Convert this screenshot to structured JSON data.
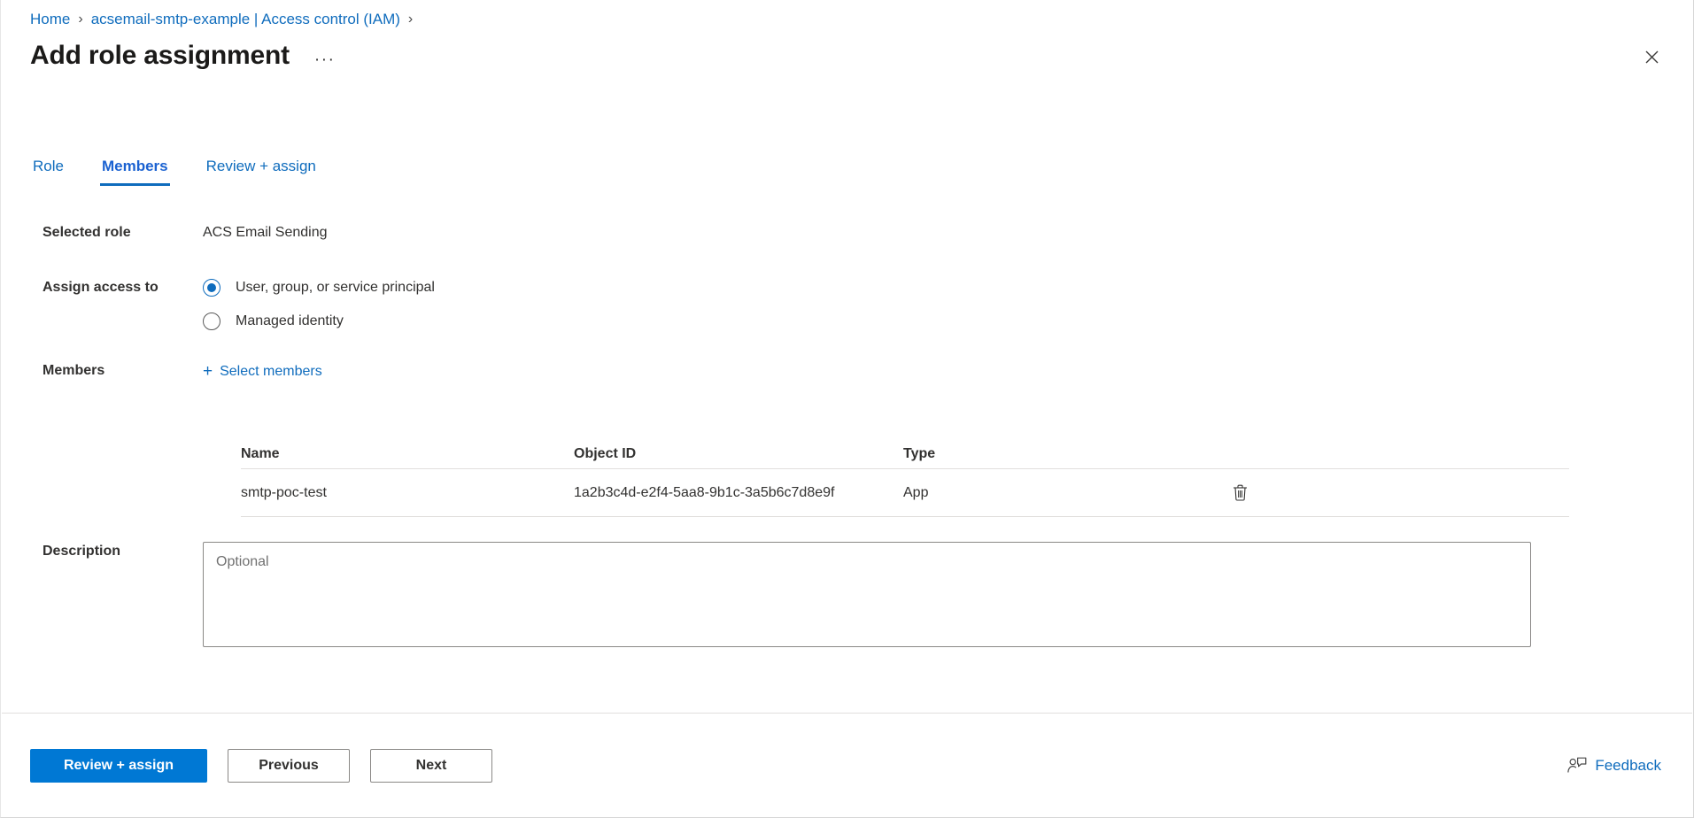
{
  "breadcrumb": {
    "items": [
      {
        "label": "Home"
      },
      {
        "label": "acsemail-smtp-example | Access control (IAM)"
      }
    ],
    "separator": "›"
  },
  "header": {
    "title": "Add role assignment",
    "more_label": "···",
    "close_label": "×"
  },
  "tabs": [
    {
      "label": "Role",
      "active": false
    },
    {
      "label": "Members",
      "active": true
    },
    {
      "label": "Review + assign",
      "active": false
    }
  ],
  "form": {
    "selected_role": {
      "label": "Selected role",
      "value": "ACS Email Sending"
    },
    "assign_access_to": {
      "label": "Assign access to",
      "options": [
        {
          "label": "User, group, or service principal",
          "checked": true
        },
        {
          "label": "Managed identity",
          "checked": false
        }
      ]
    },
    "members": {
      "label": "Members",
      "select_link": "Select members",
      "plus_icon": "+"
    },
    "description": {
      "label": "Description",
      "placeholder": "Optional",
      "value": ""
    }
  },
  "members_table": {
    "columns": [
      "Name",
      "Object ID",
      "Type"
    ],
    "rows": [
      {
        "name": "smtp-poc-test",
        "object_id": "1a2b3c4d-e2f4-5aa8-9b1c-3a5b6c7d8e9f",
        "type": "App",
        "delete_icon": "trash-icon"
      }
    ]
  },
  "footer": {
    "primary_button": "Review + assign",
    "previous_button": "Previous",
    "next_button": "Next",
    "feedback_label": "Feedback"
  },
  "colors": {
    "accent_blue": "#0078d4",
    "link_blue": "#0f6cbd",
    "active_tab_blue": "#1b62d1",
    "text_primary": "#323130",
    "title_text": "#1b1a19",
    "border_grey": "#e1dfdd",
    "input_border": "#8a8886"
  }
}
